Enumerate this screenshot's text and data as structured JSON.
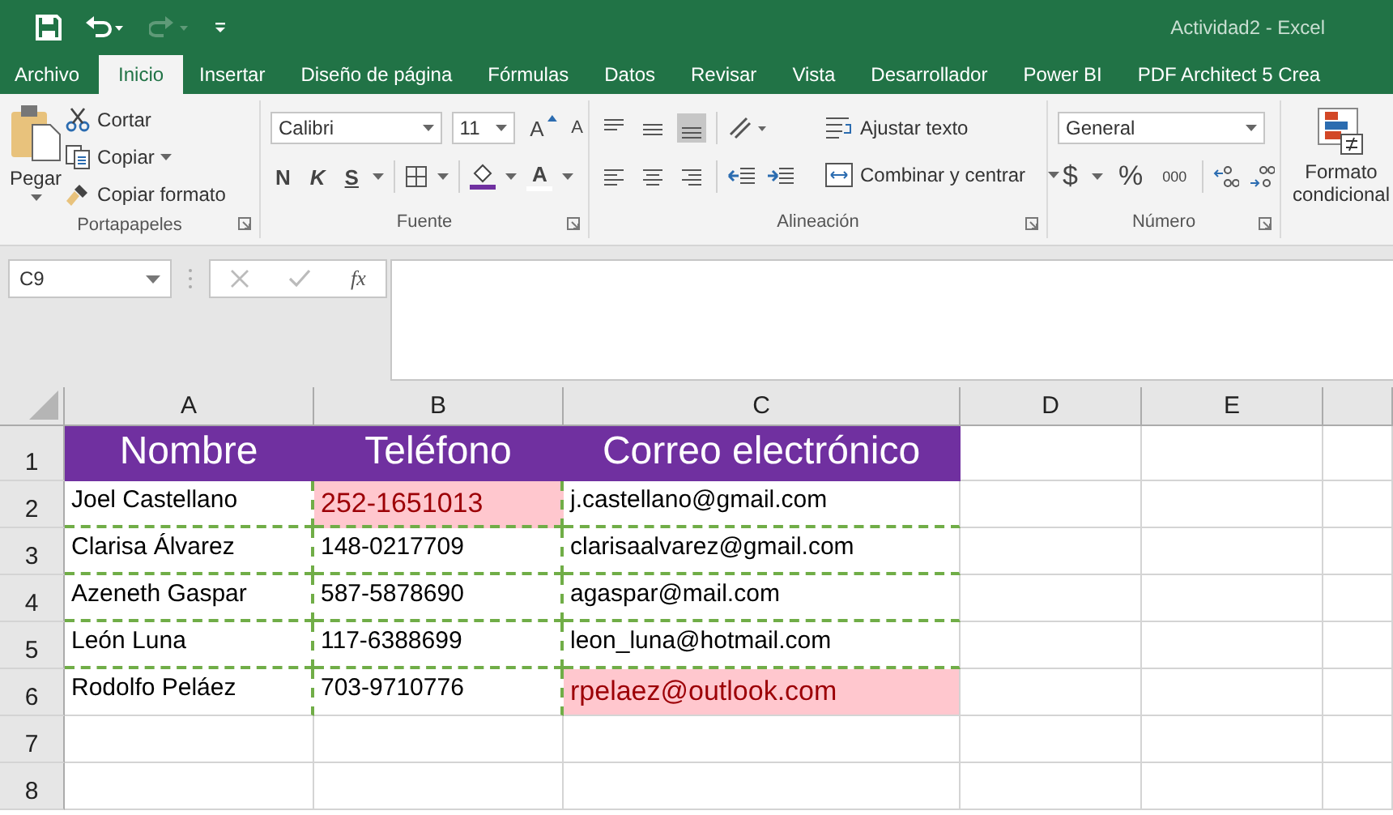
{
  "window": {
    "title": "Actividad2 - Excel"
  },
  "tabs": [
    {
      "label": "Archivo",
      "selected": false
    },
    {
      "label": "Inicio",
      "selected": true
    },
    {
      "label": "Insertar",
      "selected": false
    },
    {
      "label": "Diseño de página",
      "selected": false
    },
    {
      "label": "Fórmulas",
      "selected": false
    },
    {
      "label": "Datos",
      "selected": false
    },
    {
      "label": "Revisar",
      "selected": false
    },
    {
      "label": "Vista",
      "selected": false
    },
    {
      "label": "Desarrollador",
      "selected": false
    },
    {
      "label": "Power BI",
      "selected": false
    },
    {
      "label": "PDF Architect 5 Crea",
      "selected": false
    }
  ],
  "ribbon": {
    "clipboard": {
      "title": "Portapapeles",
      "paste": "Pegar",
      "cut": "Cortar",
      "copy": "Copiar",
      "format_painter": "Copiar formato"
    },
    "font": {
      "title": "Fuente",
      "font_name": "Calibri",
      "font_size": "11",
      "grow": "A",
      "shrink": "A",
      "bold": "N",
      "italic": "K",
      "underline": "S",
      "font_color": "A"
    },
    "alignment": {
      "title": "Alineación",
      "wrap_text": "Ajustar texto",
      "merge_center": "Combinar y centrar"
    },
    "number": {
      "title": "Número",
      "format": "General",
      "currency": "$",
      "percent": "%",
      "thousands": "000"
    },
    "styles": {
      "conditional_format": "Formato condicional"
    }
  },
  "formula_bar": {
    "name_box": "C9",
    "fx": "fx"
  },
  "columns": [
    "A",
    "B",
    "C",
    "D",
    "E"
  ],
  "row_numbers": [
    "1",
    "2",
    "3",
    "4",
    "5",
    "6",
    "7",
    "8"
  ],
  "header": [
    "Nombre",
    "Teléfono",
    "Correo electrónico"
  ],
  "records": [
    {
      "cells": [
        {
          "text": "Joel Castellano",
          "highlighted": false
        },
        {
          "text": "252-1651013",
          "highlighted": true
        },
        {
          "text": "j.castellano@gmail.com",
          "highlighted": false
        }
      ]
    },
    {
      "cells": [
        {
          "text": "Clarisa Álvarez",
          "highlighted": false
        },
        {
          "text": "148-0217709",
          "highlighted": false
        },
        {
          "text": "clarisaalvarez@gmail.com",
          "highlighted": false
        }
      ]
    },
    {
      "cells": [
        {
          "text": "Azeneth Gaspar",
          "highlighted": false
        },
        {
          "text": "587-5878690",
          "highlighted": false
        },
        {
          "text": "agaspar@mail.com",
          "highlighted": false
        }
      ]
    },
    {
      "cells": [
        {
          "text": "León Luna",
          "highlighted": false
        },
        {
          "text": "117-6388699",
          "highlighted": false
        },
        {
          "text": "leon_luna@hotmail.com",
          "highlighted": false
        }
      ]
    },
    {
      "cells": [
        {
          "text": "Rodolfo Peláez",
          "highlighted": false
        },
        {
          "text": "703-9710776",
          "highlighted": false
        },
        {
          "text": "rpelaez@outlook.com",
          "highlighted": true
        }
      ]
    }
  ]
}
